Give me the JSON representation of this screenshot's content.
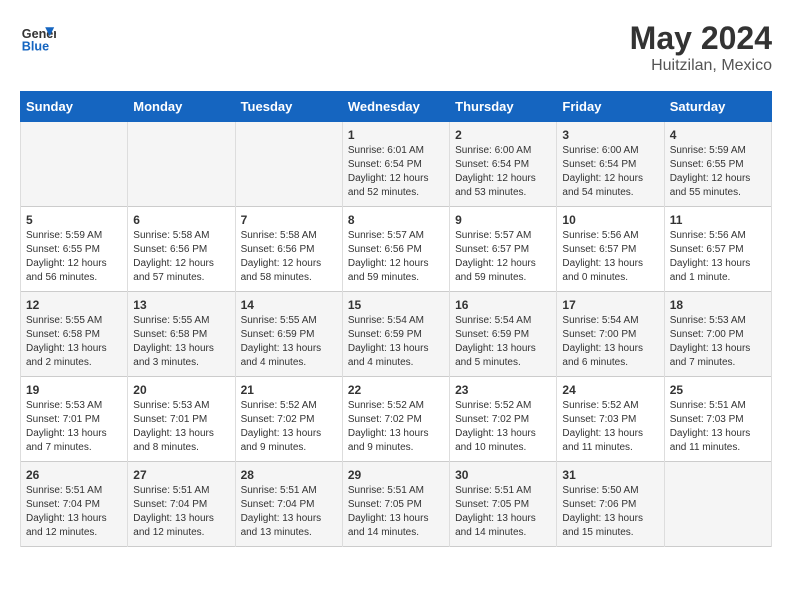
{
  "header": {
    "logo_line1": "General",
    "logo_line2": "Blue",
    "main_title": "May 2024",
    "subtitle": "Huitzilan, Mexico"
  },
  "days_of_week": [
    "Sunday",
    "Monday",
    "Tuesday",
    "Wednesday",
    "Thursday",
    "Friday",
    "Saturday"
  ],
  "weeks": [
    [
      {
        "day": "",
        "content": ""
      },
      {
        "day": "",
        "content": ""
      },
      {
        "day": "",
        "content": ""
      },
      {
        "day": "1",
        "content": "Sunrise: 6:01 AM\nSunset: 6:54 PM\nDaylight: 12 hours\nand 52 minutes."
      },
      {
        "day": "2",
        "content": "Sunrise: 6:00 AM\nSunset: 6:54 PM\nDaylight: 12 hours\nand 53 minutes."
      },
      {
        "day": "3",
        "content": "Sunrise: 6:00 AM\nSunset: 6:54 PM\nDaylight: 12 hours\nand 54 minutes."
      },
      {
        "day": "4",
        "content": "Sunrise: 5:59 AM\nSunset: 6:55 PM\nDaylight: 12 hours\nand 55 minutes."
      }
    ],
    [
      {
        "day": "5",
        "content": "Sunrise: 5:59 AM\nSunset: 6:55 PM\nDaylight: 12 hours\nand 56 minutes."
      },
      {
        "day": "6",
        "content": "Sunrise: 5:58 AM\nSunset: 6:56 PM\nDaylight: 12 hours\nand 57 minutes."
      },
      {
        "day": "7",
        "content": "Sunrise: 5:58 AM\nSunset: 6:56 PM\nDaylight: 12 hours\nand 58 minutes."
      },
      {
        "day": "8",
        "content": "Sunrise: 5:57 AM\nSunset: 6:56 PM\nDaylight: 12 hours\nand 59 minutes."
      },
      {
        "day": "9",
        "content": "Sunrise: 5:57 AM\nSunset: 6:57 PM\nDaylight: 12 hours\nand 59 minutes."
      },
      {
        "day": "10",
        "content": "Sunrise: 5:56 AM\nSunset: 6:57 PM\nDaylight: 13 hours\nand 0 minutes."
      },
      {
        "day": "11",
        "content": "Sunrise: 5:56 AM\nSunset: 6:57 PM\nDaylight: 13 hours\nand 1 minute."
      }
    ],
    [
      {
        "day": "12",
        "content": "Sunrise: 5:55 AM\nSunset: 6:58 PM\nDaylight: 13 hours\nand 2 minutes."
      },
      {
        "day": "13",
        "content": "Sunrise: 5:55 AM\nSunset: 6:58 PM\nDaylight: 13 hours\nand 3 minutes."
      },
      {
        "day": "14",
        "content": "Sunrise: 5:55 AM\nSunset: 6:59 PM\nDaylight: 13 hours\nand 4 minutes."
      },
      {
        "day": "15",
        "content": "Sunrise: 5:54 AM\nSunset: 6:59 PM\nDaylight: 13 hours\nand 4 minutes."
      },
      {
        "day": "16",
        "content": "Sunrise: 5:54 AM\nSunset: 6:59 PM\nDaylight: 13 hours\nand 5 minutes."
      },
      {
        "day": "17",
        "content": "Sunrise: 5:54 AM\nSunset: 7:00 PM\nDaylight: 13 hours\nand 6 minutes."
      },
      {
        "day": "18",
        "content": "Sunrise: 5:53 AM\nSunset: 7:00 PM\nDaylight: 13 hours\nand 7 minutes."
      }
    ],
    [
      {
        "day": "19",
        "content": "Sunrise: 5:53 AM\nSunset: 7:01 PM\nDaylight: 13 hours\nand 7 minutes."
      },
      {
        "day": "20",
        "content": "Sunrise: 5:53 AM\nSunset: 7:01 PM\nDaylight: 13 hours\nand 8 minutes."
      },
      {
        "day": "21",
        "content": "Sunrise: 5:52 AM\nSunset: 7:02 PM\nDaylight: 13 hours\nand 9 minutes."
      },
      {
        "day": "22",
        "content": "Sunrise: 5:52 AM\nSunset: 7:02 PM\nDaylight: 13 hours\nand 9 minutes."
      },
      {
        "day": "23",
        "content": "Sunrise: 5:52 AM\nSunset: 7:02 PM\nDaylight: 13 hours\nand 10 minutes."
      },
      {
        "day": "24",
        "content": "Sunrise: 5:52 AM\nSunset: 7:03 PM\nDaylight: 13 hours\nand 11 minutes."
      },
      {
        "day": "25",
        "content": "Sunrise: 5:51 AM\nSunset: 7:03 PM\nDaylight: 13 hours\nand 11 minutes."
      }
    ],
    [
      {
        "day": "26",
        "content": "Sunrise: 5:51 AM\nSunset: 7:04 PM\nDaylight: 13 hours\nand 12 minutes."
      },
      {
        "day": "27",
        "content": "Sunrise: 5:51 AM\nSunset: 7:04 PM\nDaylight: 13 hours\nand 12 minutes."
      },
      {
        "day": "28",
        "content": "Sunrise: 5:51 AM\nSunset: 7:04 PM\nDaylight: 13 hours\nand 13 minutes."
      },
      {
        "day": "29",
        "content": "Sunrise: 5:51 AM\nSunset: 7:05 PM\nDaylight: 13 hours\nand 14 minutes."
      },
      {
        "day": "30",
        "content": "Sunrise: 5:51 AM\nSunset: 7:05 PM\nDaylight: 13 hours\nand 14 minutes."
      },
      {
        "day": "31",
        "content": "Sunrise: 5:50 AM\nSunset: 7:06 PM\nDaylight: 13 hours\nand 15 minutes."
      },
      {
        "day": "",
        "content": ""
      }
    ]
  ]
}
